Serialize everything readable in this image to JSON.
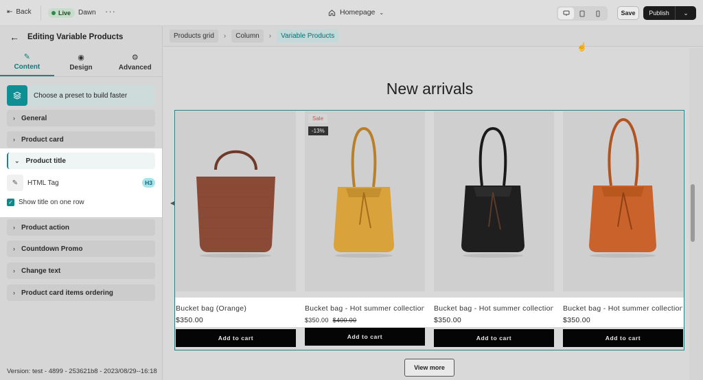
{
  "topbar": {
    "back_label": "Back",
    "live_label": "Live",
    "theme_name": "Dawn",
    "more_label": "···",
    "page_selector": "Homepage",
    "save_label": "Save",
    "publish_label": "Publish"
  },
  "sidebar": {
    "title": "Editing Variable Products",
    "tabs": [
      {
        "label": "Content",
        "icon": "pencil-icon",
        "active": true
      },
      {
        "label": "Design",
        "icon": "palette-icon",
        "active": false
      },
      {
        "label": "Advanced",
        "icon": "gear-icon",
        "active": false
      }
    ],
    "preset_label": "Choose a preset to build faster",
    "sections": [
      {
        "label": "General"
      },
      {
        "label": "Product card"
      },
      {
        "label": "Product title"
      },
      {
        "label": "Product action"
      },
      {
        "label": "Countdown Promo"
      },
      {
        "label": "Change text"
      },
      {
        "label": "Product card items ordering"
      }
    ],
    "product_title_panel": {
      "html_tag_label": "HTML Tag",
      "html_tag_value": "H3",
      "one_row_label": "Show title on one row",
      "one_row_checked": true
    },
    "version": "Version: test - 4899 - 253621b8 - 2023/08/29--16:18"
  },
  "breadcrumb": [
    "Products grid",
    "Column",
    "Variable Products"
  ],
  "canvas": {
    "heading": "New arrivals",
    "products": [
      {
        "title": "Bucket bag (Orange)",
        "price": "$350.00",
        "old_price": "",
        "button": "Add to cart",
        "bag_color": "#8b4a35",
        "type": "straw"
      },
      {
        "title": "Bucket bag - Hot summer collection",
        "price": "$350.00",
        "old_price": "$400.00",
        "button": "Add to cart",
        "bag_color": "#d9a23a",
        "type": "bucket",
        "badge_sale": "Sale",
        "badge_discount": "-13%"
      },
      {
        "title": "Bucket bag - Hot summer collection",
        "price": "$350.00",
        "old_price": "",
        "button": "Add to cart",
        "bag_color": "#1f1f1f",
        "type": "bucket"
      },
      {
        "title": "Bucket bag - Hot summer collection",
        "price": "$350.00",
        "old_price": "",
        "button": "Add to cart",
        "bag_color": "#c9622b",
        "type": "bucket"
      }
    ],
    "view_more": "View more"
  },
  "colors": {
    "accent": "#14868a",
    "dark": "#050505"
  }
}
